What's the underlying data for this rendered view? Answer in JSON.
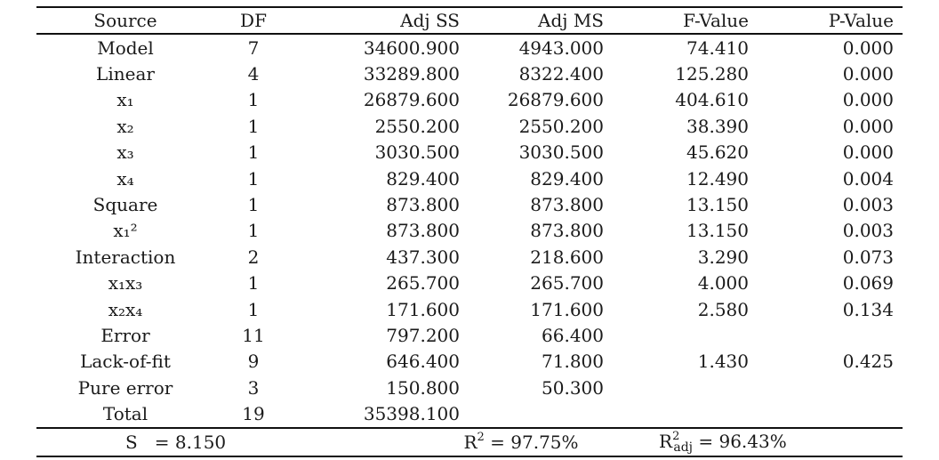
{
  "table": {
    "headers": [
      "Source",
      "DF",
      "Adj SS",
      "Adj MS",
      "F-Value",
      "P-Value"
    ],
    "rows": [
      {
        "source": "Model",
        "df": "7",
        "adj_ss": "34600.900",
        "adj_ms": "4943.000",
        "f": "74.410",
        "p": "0.000"
      },
      {
        "source": "Linear",
        "df": "4",
        "adj_ss": "33289.800",
        "adj_ms": "8322.400",
        "f": "125.280",
        "p": "0.000"
      },
      {
        "source": "x₁",
        "df": "1",
        "adj_ss": "26879.600",
        "adj_ms": "26879.600",
        "f": "404.610",
        "p": "0.000"
      },
      {
        "source": "x₂",
        "df": "1",
        "adj_ss": "2550.200",
        "adj_ms": "2550.200",
        "f": "38.390",
        "p": "0.000"
      },
      {
        "source": "x₃",
        "df": "1",
        "adj_ss": "3030.500",
        "adj_ms": "3030.500",
        "f": "45.620",
        "p": "0.000"
      },
      {
        "source": "x₄",
        "df": "1",
        "adj_ss": "829.400",
        "adj_ms": "829.400",
        "f": "12.490",
        "p": "0.004"
      },
      {
        "source": "Square",
        "df": "1",
        "adj_ss": "873.800",
        "adj_ms": "873.800",
        "f": "13.150",
        "p": "0.003"
      },
      {
        "source": "x₁²",
        "df": "1",
        "adj_ss": "873.800",
        "adj_ms": "873.800",
        "f": "13.150",
        "p": "0.003"
      },
      {
        "source": "Interaction",
        "df": "2",
        "adj_ss": "437.300",
        "adj_ms": "218.600",
        "f": "3.290",
        "p": "0.073"
      },
      {
        "source": "x₁x₃",
        "df": "1",
        "adj_ss": "265.700",
        "adj_ms": "265.700",
        "f": "4.000",
        "p": "0.069"
      },
      {
        "source": "x₂x₄",
        "df": "1",
        "adj_ss": "171.600",
        "adj_ms": "171.600",
        "f": "2.580",
        "p": "0.134"
      },
      {
        "source": "Error",
        "df": "11",
        "adj_ss": "797.200",
        "adj_ms": "66.400",
        "f": "",
        "p": ""
      },
      {
        "source": "Lack-of-fit",
        "df": "9",
        "adj_ss": "646.400",
        "adj_ms": "71.800",
        "f": "1.430",
        "p": "0.425"
      },
      {
        "source": "Pure error",
        "df": "3",
        "adj_ss": "150.800",
        "adj_ms": "50.300",
        "f": "",
        "p": ""
      },
      {
        "source": "Total",
        "df": "19",
        "adj_ss": "35398.100",
        "adj_ms": "",
        "f": "",
        "p": ""
      }
    ],
    "summary": {
      "s_label": "S",
      "s_value": "= 8.150",
      "r2_label": "R",
      "r2_sup": "2",
      "r2_value": " = 97.75%",
      "r2adj_label": "R",
      "r2adj_sup": "2",
      "r2adj_sub": "adj",
      "r2adj_value": " = 96.43%"
    }
  }
}
